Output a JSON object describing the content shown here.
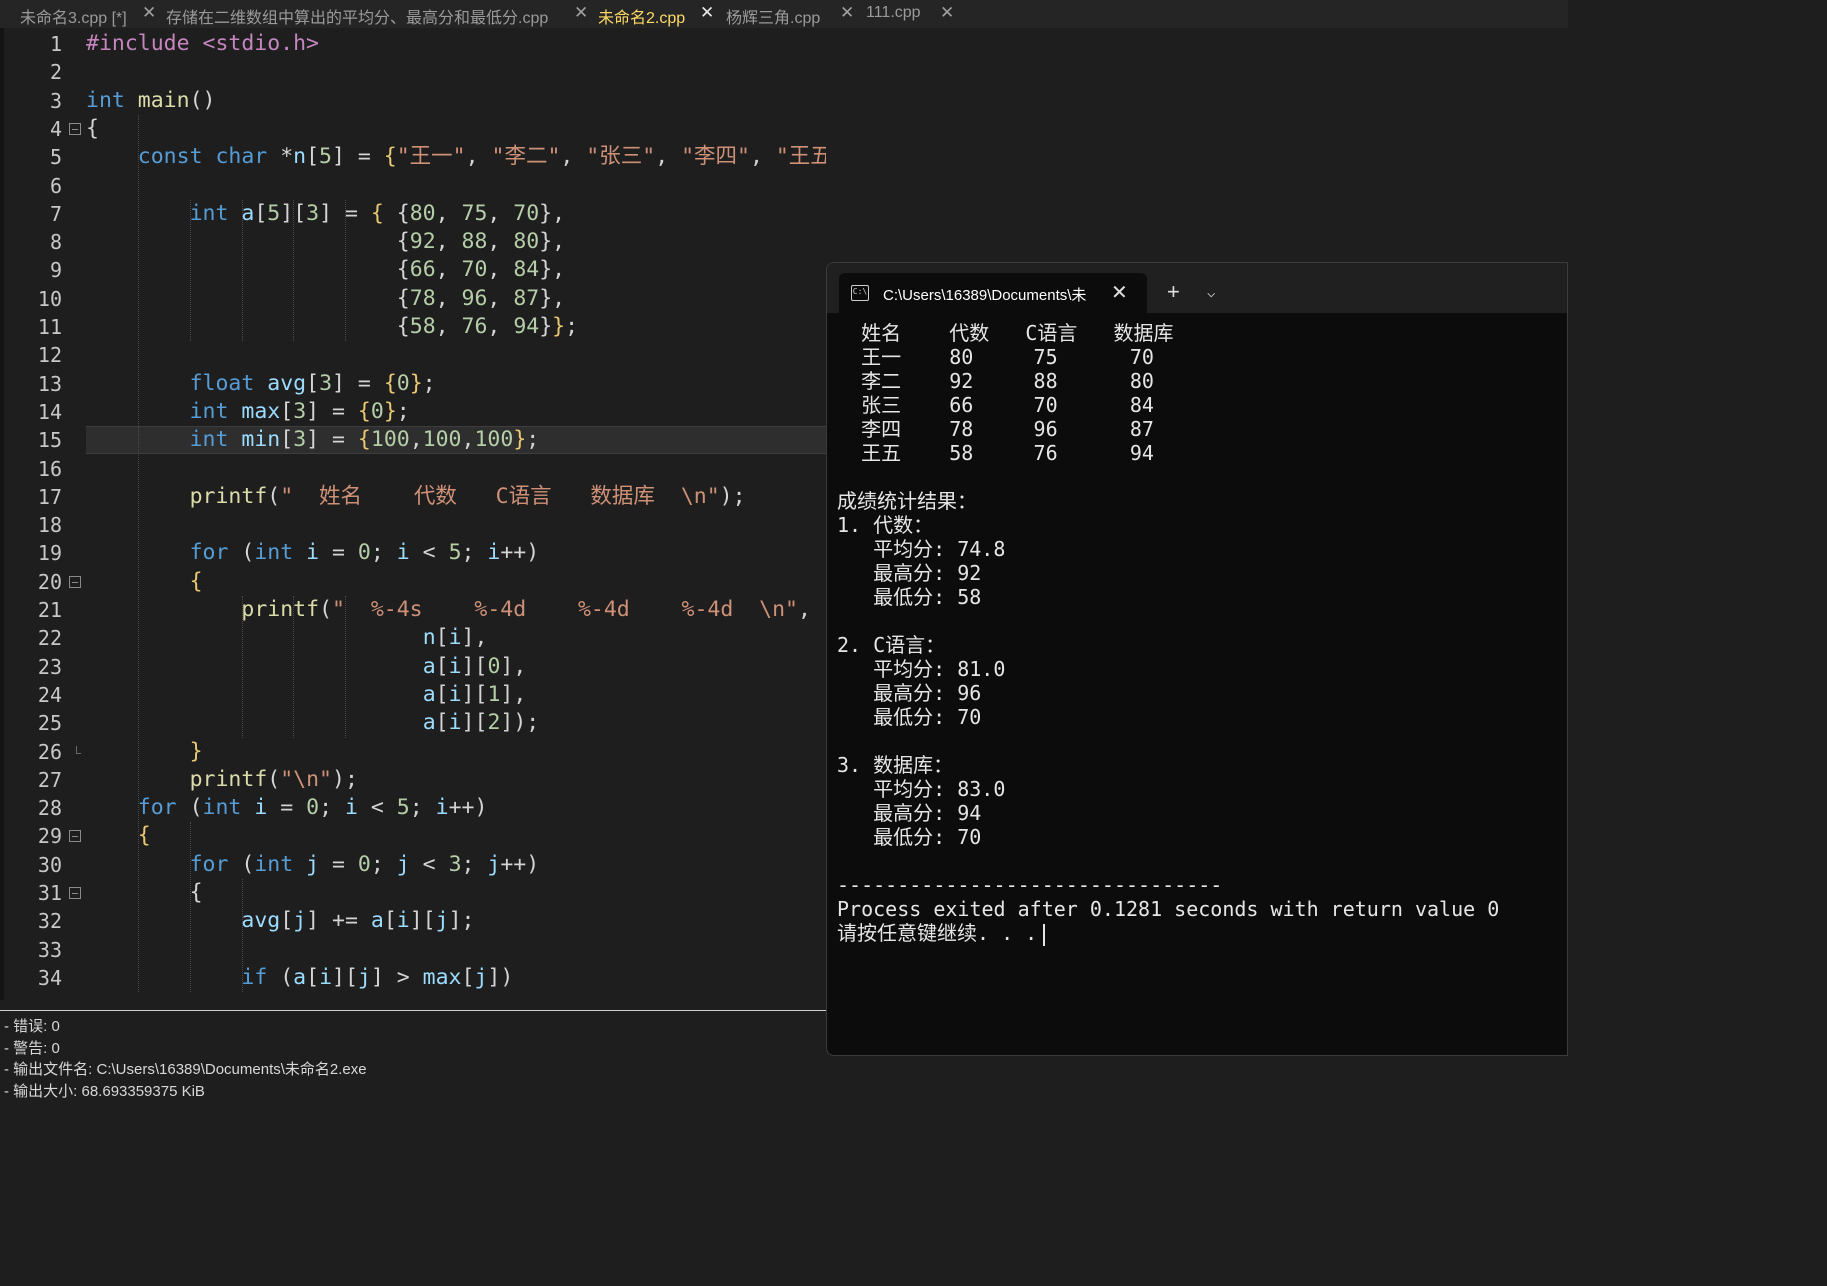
{
  "tabs": [
    {
      "label": "未命名3.cpp [*]",
      "close": "✕"
    },
    {
      "label": "存储在二维数组中算出的平均分、最高分和最低分.cpp",
      "close": "✕"
    },
    {
      "label": "未命名2.cpp",
      "close": "✕",
      "active": true
    },
    {
      "label": "杨辉三角.cpp",
      "close": "✕"
    },
    {
      "label": "111.cpp",
      "close": "✕"
    }
  ],
  "editor": {
    "line_numbers": [
      "1",
      "2",
      "3",
      "4",
      "5",
      "6",
      "7",
      "8",
      "9",
      "10",
      "11",
      "12",
      "13",
      "14",
      "15",
      "16",
      "17",
      "18",
      "19",
      "20",
      "21",
      "22",
      "23",
      "24",
      "25",
      "26",
      "27",
      "28",
      "29",
      "30",
      "31",
      "32",
      "33",
      "34"
    ],
    "current_line": 15,
    "code": [
      {
        "ln": 1,
        "indent": 0,
        "t": [
          [
            "pp",
            "#include <stdio.h>"
          ]
        ]
      },
      {
        "ln": 3,
        "indent": 0,
        "t": [
          [
            "kw",
            "int"
          ],
          [
            "pn",
            " "
          ],
          [
            "fn",
            "main"
          ],
          [
            "pn",
            "()"
          ]
        ]
      },
      {
        "ln": 4,
        "indent": 0,
        "t": [
          [
            "pn",
            "{"
          ]
        ]
      },
      {
        "ln": 5,
        "indent": 2,
        "t": [
          [
            "kw",
            "const char"
          ],
          [
            "pn",
            " *"
          ],
          [
            "id",
            "n"
          ],
          [
            "pn",
            "["
          ],
          [
            "num",
            "5"
          ],
          [
            "pn",
            "] = "
          ],
          [
            "br",
            "{"
          ],
          [
            "str",
            "\"王一\""
          ],
          [
            "pn",
            ", "
          ],
          [
            "str",
            "\"李二\""
          ],
          [
            "pn",
            ", "
          ],
          [
            "str",
            "\"张三\""
          ],
          [
            "pn",
            ", "
          ],
          [
            "str",
            "\"李四\""
          ],
          [
            "pn",
            ", "
          ],
          [
            "str",
            "\"王五\""
          ],
          [
            "br",
            "}"
          ],
          [
            "pn",
            ";"
          ]
        ]
      },
      {
        "ln": 7,
        "indent": 4,
        "t": [
          [
            "kw",
            "int"
          ],
          [
            "pn",
            " "
          ],
          [
            "id",
            "a"
          ],
          [
            "pn",
            "["
          ],
          [
            "num",
            "5"
          ],
          [
            "pn",
            "]["
          ],
          [
            "num",
            "3"
          ],
          [
            "pn",
            "] = "
          ],
          [
            "br",
            "{"
          ],
          [
            "pn",
            " {"
          ],
          [
            "num",
            "80"
          ],
          [
            "pn",
            ", "
          ],
          [
            "num",
            "75"
          ],
          [
            "pn",
            ", "
          ],
          [
            "num",
            "70"
          ],
          [
            "pn",
            "},"
          ]
        ]
      },
      {
        "ln": 8,
        "indent": 12,
        "t": [
          [
            "pn",
            "{"
          ],
          [
            "num",
            "92"
          ],
          [
            "pn",
            ", "
          ],
          [
            "num",
            "88"
          ],
          [
            "pn",
            ", "
          ],
          [
            "num",
            "80"
          ],
          [
            "pn",
            "},"
          ]
        ]
      },
      {
        "ln": 9,
        "indent": 12,
        "t": [
          [
            "pn",
            "{"
          ],
          [
            "num",
            "66"
          ],
          [
            "pn",
            ", "
          ],
          [
            "num",
            "70"
          ],
          [
            "pn",
            ", "
          ],
          [
            "num",
            "84"
          ],
          [
            "pn",
            "},"
          ]
        ]
      },
      {
        "ln": 10,
        "indent": 12,
        "t": [
          [
            "pn",
            "{"
          ],
          [
            "num",
            "78"
          ],
          [
            "pn",
            ", "
          ],
          [
            "num",
            "96"
          ],
          [
            "pn",
            ", "
          ],
          [
            "num",
            "87"
          ],
          [
            "pn",
            "},"
          ]
        ]
      },
      {
        "ln": 11,
        "indent": 12,
        "t": [
          [
            "pn",
            "{"
          ],
          [
            "num",
            "58"
          ],
          [
            "pn",
            ", "
          ],
          [
            "num",
            "76"
          ],
          [
            "pn",
            ", "
          ],
          [
            "num",
            "94"
          ],
          [
            "pn",
            "}"
          ],
          [
            "br",
            "}"
          ],
          [
            "pn",
            ";"
          ]
        ]
      },
      {
        "ln": 13,
        "indent": 4,
        "t": [
          [
            "kw",
            "float"
          ],
          [
            "pn",
            " "
          ],
          [
            "id",
            "avg"
          ],
          [
            "pn",
            "["
          ],
          [
            "num",
            "3"
          ],
          [
            "pn",
            "] = "
          ],
          [
            "br",
            "{"
          ],
          [
            "num",
            "0"
          ],
          [
            "br",
            "}"
          ],
          [
            "pn",
            ";"
          ]
        ]
      },
      {
        "ln": 14,
        "indent": 4,
        "t": [
          [
            "kw",
            "int"
          ],
          [
            "pn",
            " "
          ],
          [
            "id",
            "max"
          ],
          [
            "pn",
            "["
          ],
          [
            "num",
            "3"
          ],
          [
            "pn",
            "] = "
          ],
          [
            "br",
            "{"
          ],
          [
            "num",
            "0"
          ],
          [
            "br",
            "}"
          ],
          [
            "pn",
            ";"
          ]
        ]
      },
      {
        "ln": 15,
        "indent": 4,
        "t": [
          [
            "kw",
            "int"
          ],
          [
            "pn",
            " "
          ],
          [
            "id",
            "min"
          ],
          [
            "pn",
            "["
          ],
          [
            "num",
            "3"
          ],
          [
            "pn",
            "] = "
          ],
          [
            "br",
            "{"
          ],
          [
            "num",
            "100"
          ],
          [
            "pn",
            ","
          ],
          [
            "num",
            "100"
          ],
          [
            "pn",
            ","
          ],
          [
            "num",
            "100"
          ],
          [
            "br",
            "}"
          ],
          [
            "pn",
            ";"
          ]
        ]
      },
      {
        "ln": 17,
        "indent": 4,
        "t": [
          [
            "fn",
            "printf"
          ],
          [
            "pn",
            "("
          ],
          [
            "str",
            "\"  姓名    代数   C语言   数据库  \\n\""
          ],
          [
            "pn",
            ");"
          ]
        ]
      },
      {
        "ln": 19,
        "indent": 4,
        "t": [
          [
            "kw",
            "for"
          ],
          [
            "pn",
            " ("
          ],
          [
            "kw",
            "int"
          ],
          [
            "pn",
            " "
          ],
          [
            "id",
            "i"
          ],
          [
            "pn",
            " = "
          ],
          [
            "num",
            "0"
          ],
          [
            "pn",
            "; "
          ],
          [
            "id",
            "i"
          ],
          [
            "pn",
            " < "
          ],
          [
            "num",
            "5"
          ],
          [
            "pn",
            "; "
          ],
          [
            "id",
            "i"
          ],
          [
            "pn",
            "++)"
          ]
        ]
      },
      {
        "ln": 20,
        "indent": 4,
        "t": [
          [
            "br",
            "{"
          ]
        ]
      },
      {
        "ln": 21,
        "indent": 6,
        "t": [
          [
            "fn",
            "printf"
          ],
          [
            "pn",
            "("
          ],
          [
            "str",
            "\"  %-4s    %-4d    %-4d    %-4d  \\n\""
          ],
          [
            "pn",
            ","
          ]
        ]
      },
      {
        "ln": 22,
        "indent": 13,
        "t": [
          [
            "id",
            "n"
          ],
          [
            "pn",
            "["
          ],
          [
            "id",
            "i"
          ],
          [
            "pn",
            "],"
          ]
        ]
      },
      {
        "ln": 23,
        "indent": 13,
        "t": [
          [
            "id",
            "a"
          ],
          [
            "pn",
            "["
          ],
          [
            "id",
            "i"
          ],
          [
            "pn",
            "]["
          ],
          [
            "num",
            "0"
          ],
          [
            "pn",
            "],"
          ]
        ]
      },
      {
        "ln": 24,
        "indent": 13,
        "t": [
          [
            "id",
            "a"
          ],
          [
            "pn",
            "["
          ],
          [
            "id",
            "i"
          ],
          [
            "pn",
            "]["
          ],
          [
            "num",
            "1"
          ],
          [
            "pn",
            "],"
          ]
        ]
      },
      {
        "ln": 25,
        "indent": 13,
        "t": [
          [
            "id",
            "a"
          ],
          [
            "pn",
            "["
          ],
          [
            "id",
            "i"
          ],
          [
            "pn",
            "]["
          ],
          [
            "num",
            "2"
          ],
          [
            "pn",
            "]);"
          ]
        ]
      },
      {
        "ln": 26,
        "indent": 4,
        "t": [
          [
            "br",
            "}"
          ]
        ]
      },
      {
        "ln": 27,
        "indent": 4,
        "t": [
          [
            "fn",
            "printf"
          ],
          [
            "pn",
            "("
          ],
          [
            "str",
            "\"\\n\""
          ],
          [
            "pn",
            ");"
          ]
        ]
      },
      {
        "ln": 28,
        "indent": 2,
        "t": [
          [
            "kw",
            "for"
          ],
          [
            "pn",
            " ("
          ],
          [
            "kw",
            "int"
          ],
          [
            "pn",
            " "
          ],
          [
            "id",
            "i"
          ],
          [
            "pn",
            " = "
          ],
          [
            "num",
            "0"
          ],
          [
            "pn",
            "; "
          ],
          [
            "id",
            "i"
          ],
          [
            "pn",
            " < "
          ],
          [
            "num",
            "5"
          ],
          [
            "pn",
            "; "
          ],
          [
            "id",
            "i"
          ],
          [
            "pn",
            "++)"
          ]
        ]
      },
      {
        "ln": 29,
        "indent": 2,
        "t": [
          [
            "br",
            "{"
          ]
        ]
      },
      {
        "ln": 30,
        "indent": 4,
        "t": [
          [
            "kw",
            "for"
          ],
          [
            "pn",
            " ("
          ],
          [
            "kw",
            "int"
          ],
          [
            "pn",
            " "
          ],
          [
            "id",
            "j"
          ],
          [
            "pn",
            " = "
          ],
          [
            "num",
            "0"
          ],
          [
            "pn",
            "; "
          ],
          [
            "id",
            "j"
          ],
          [
            "pn",
            " < "
          ],
          [
            "num",
            "3"
          ],
          [
            "pn",
            "; "
          ],
          [
            "id",
            "j"
          ],
          [
            "pn",
            "++)"
          ]
        ]
      },
      {
        "ln": 31,
        "indent": 4,
        "t": [
          [
            "pn",
            "{"
          ]
        ]
      },
      {
        "ln": 32,
        "indent": 6,
        "t": [
          [
            "id",
            "avg"
          ],
          [
            "pn",
            "["
          ],
          [
            "id",
            "j"
          ],
          [
            "pn",
            "] += "
          ],
          [
            "id",
            "a"
          ],
          [
            "pn",
            "["
          ],
          [
            "id",
            "i"
          ],
          [
            "pn",
            "]["
          ],
          [
            "id",
            "j"
          ],
          [
            "pn",
            "];"
          ]
        ]
      },
      {
        "ln": 34,
        "indent": 6,
        "t": [
          [
            "kw",
            "if"
          ],
          [
            "pn",
            " ("
          ],
          [
            "id",
            "a"
          ],
          [
            "pn",
            "["
          ],
          [
            "id",
            "i"
          ],
          [
            "pn",
            "]["
          ],
          [
            "id",
            "j"
          ],
          [
            "pn",
            "] > "
          ],
          [
            "id",
            "max"
          ],
          [
            "pn",
            "["
          ],
          [
            "id",
            "j"
          ],
          [
            "pn",
            "])"
          ]
        ]
      }
    ]
  },
  "compile_log": [
    "- 错误: 0",
    "- 警告: 0",
    "- 输出文件名: C:\\Users\\16389\\Documents\\未命名2.exe",
    "- 输出大小: 68.693359375 KiB"
  ],
  "terminal": {
    "tab_title": "C:\\Users\\16389\\Documents\\未",
    "icon": "console-icon",
    "close": "✕",
    "new_tab": "+",
    "dropdown": "⌄",
    "output": "  姓名    代数   C语言   数据库\n  王一    80     75      70\n  李二    92     88      80\n  张三    66     70      84\n  李四    78     96      87\n  王五    58     76      94\n\n成绩统计结果：\n1. 代数：\n   平均分: 74.8\n   最高分: 92\n   最低分: 58\n\n2. C语言：\n   平均分: 81.0\n   最高分: 96\n   最低分: 70\n\n3. 数据库：\n   平均分: 83.0\n   最高分: 94\n   最低分: 70\n\n--------------------------------\nProcess exited after 0.1281 seconds with return value 0\n请按任意键继续. . ."
  }
}
